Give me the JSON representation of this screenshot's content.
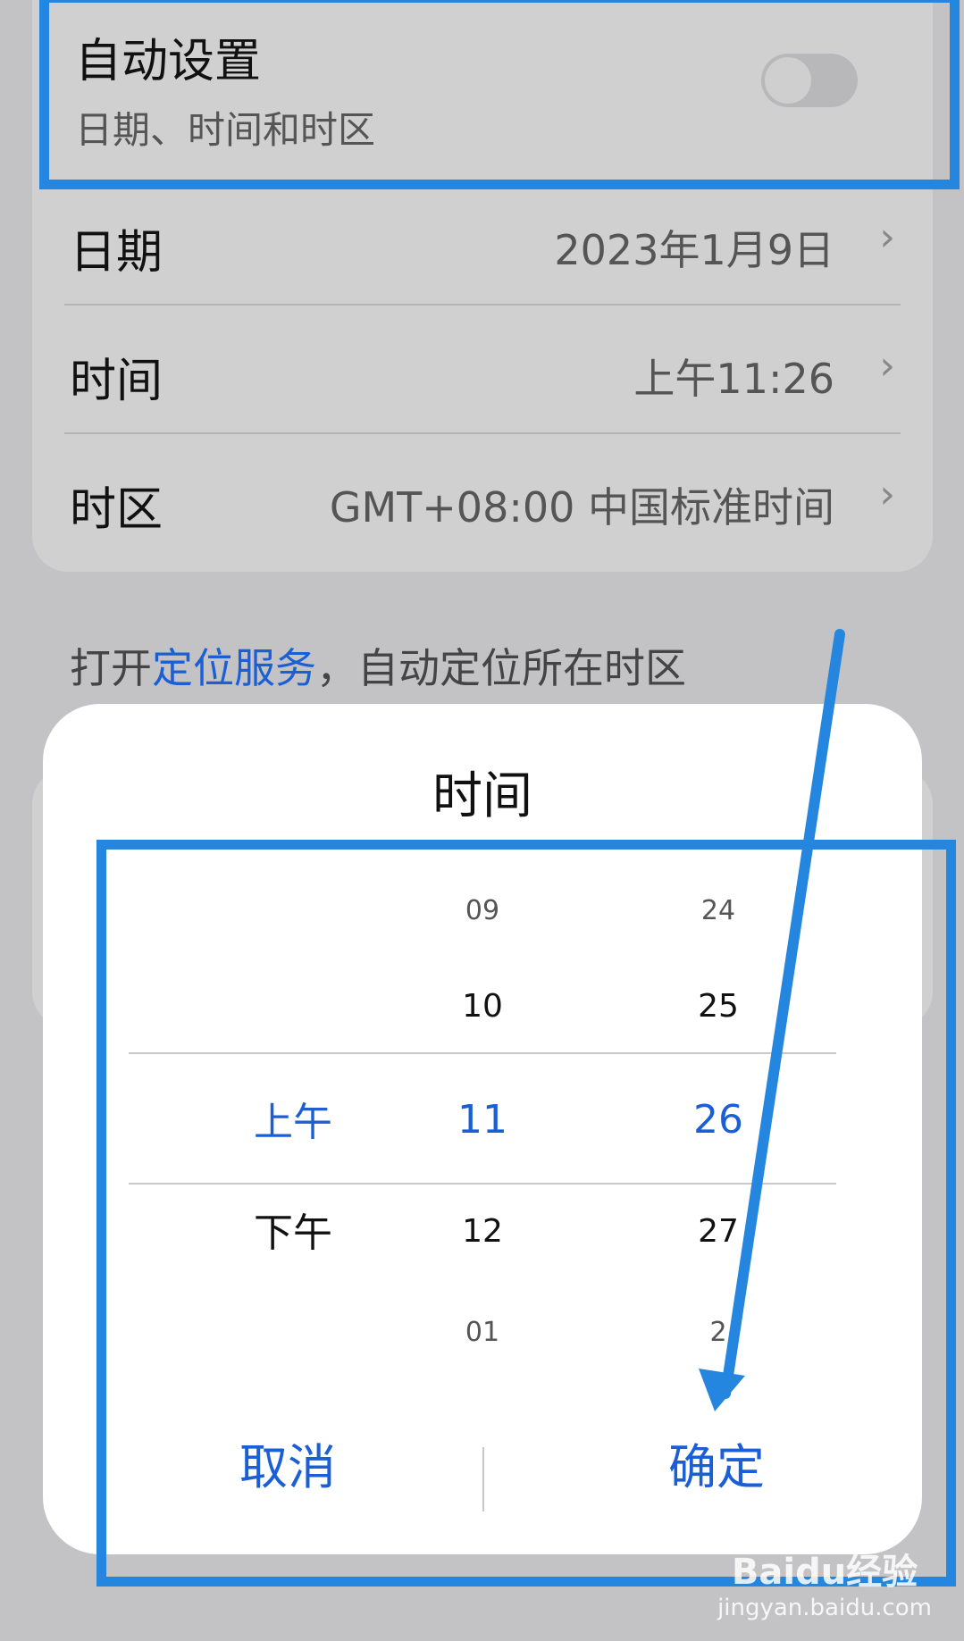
{
  "auto_setting": {
    "title": "自动设置",
    "subtitle": "日期、时间和时区",
    "enabled": false
  },
  "rows": [
    {
      "label": "日期",
      "value": "2023年1月9日"
    },
    {
      "label": "时间",
      "value": "上午11:26"
    },
    {
      "label": "时区",
      "value": "GMT+08:00 中国标准时间"
    }
  ],
  "footnote": {
    "prefix": "打开",
    "link": "定位服务",
    "suffix": "，自动定位所在时区"
  },
  "dialog": {
    "title": "时间",
    "ampm": {
      "selected": "上午",
      "next": "下午"
    },
    "hours": [
      "09",
      "10",
      "11",
      "12",
      "01"
    ],
    "minutes": [
      "24",
      "25",
      "26",
      "27",
      "2"
    ],
    "cancel_label": "取消",
    "confirm_label": "确定"
  },
  "watermark": {
    "brand": "Baidu经验",
    "url": "jingyan.baidu.com"
  },
  "colors": {
    "accent": "#1a5fd6",
    "annotation": "#2586e0"
  }
}
